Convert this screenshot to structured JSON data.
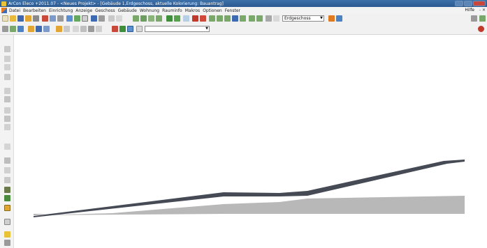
{
  "window": {
    "title": "ArCon Eleco  +2011.07 - <Neues Projekt> - [Gebäude 1,Erdgeschoss, aktuelle Kolorierung: Bauantrag]"
  },
  "menu": {
    "items": [
      "Datei",
      "Bearbeiten",
      "Einrichtung",
      "Anzeige",
      "Geschoss",
      "Gebäude",
      "Wohnung",
      "Rauminfo",
      "Makros",
      "Optionen",
      "Fenster"
    ],
    "help": "Hilfe",
    "mdi_controls": "- ✕"
  },
  "toolbar": {
    "floor_select": {
      "value": "Erdgeschoss"
    },
    "secondary_select": {
      "value": ""
    }
  },
  "colors": {
    "terrain_fill": "#b1b1b1",
    "terrain_top_edge": "#454a55",
    "accent_red": "#c0392b",
    "titlebar": "#2b5a92"
  },
  "icons": {
    "toolbar1": [
      "new-icon",
      "open-icon",
      "save-icon",
      "folder-icon",
      "print-icon",
      "cut-icon",
      "copy-icon",
      "paste-icon",
      "plan-icon",
      "3d-icon",
      "grid-icon",
      "undo-icon",
      "redo-icon",
      "zoom-icon",
      "measure-icon",
      "wall-icon",
      "door-icon",
      "window-icon",
      "stairs-icon",
      "roof-icon",
      "color-icon",
      "render-icon",
      "camera-icon",
      "light-icon",
      "help-icon"
    ],
    "toolbar2": [
      "view-icon",
      "layer-icon",
      "select-icon",
      "pointer-icon",
      "snap-icon",
      "move-icon",
      "rotate-icon",
      "dim-icon",
      "text-icon",
      "hatch-icon",
      "color-palette-icon",
      "layer-toggle-icon",
      "grid-toggle-icon"
    ],
    "left": [
      "pointer-tool-icon",
      "line-tool-icon",
      "rect-tool-icon",
      "polygon-tool-icon",
      "circle-tool-icon",
      "arc-tool-icon",
      "wall-tool-icon",
      "slab-tool-icon",
      "terrain-tool-icon",
      "stairs-tool-icon",
      "roof-tool-icon",
      "door-tool-icon",
      "window-tool-icon",
      "object-tool-icon",
      "text-tool-icon",
      "dimension-tool-icon",
      "hatch-tool-icon",
      "pen-tool-icon",
      "paint-tool-icon",
      "layer-tool-icon"
    ]
  }
}
